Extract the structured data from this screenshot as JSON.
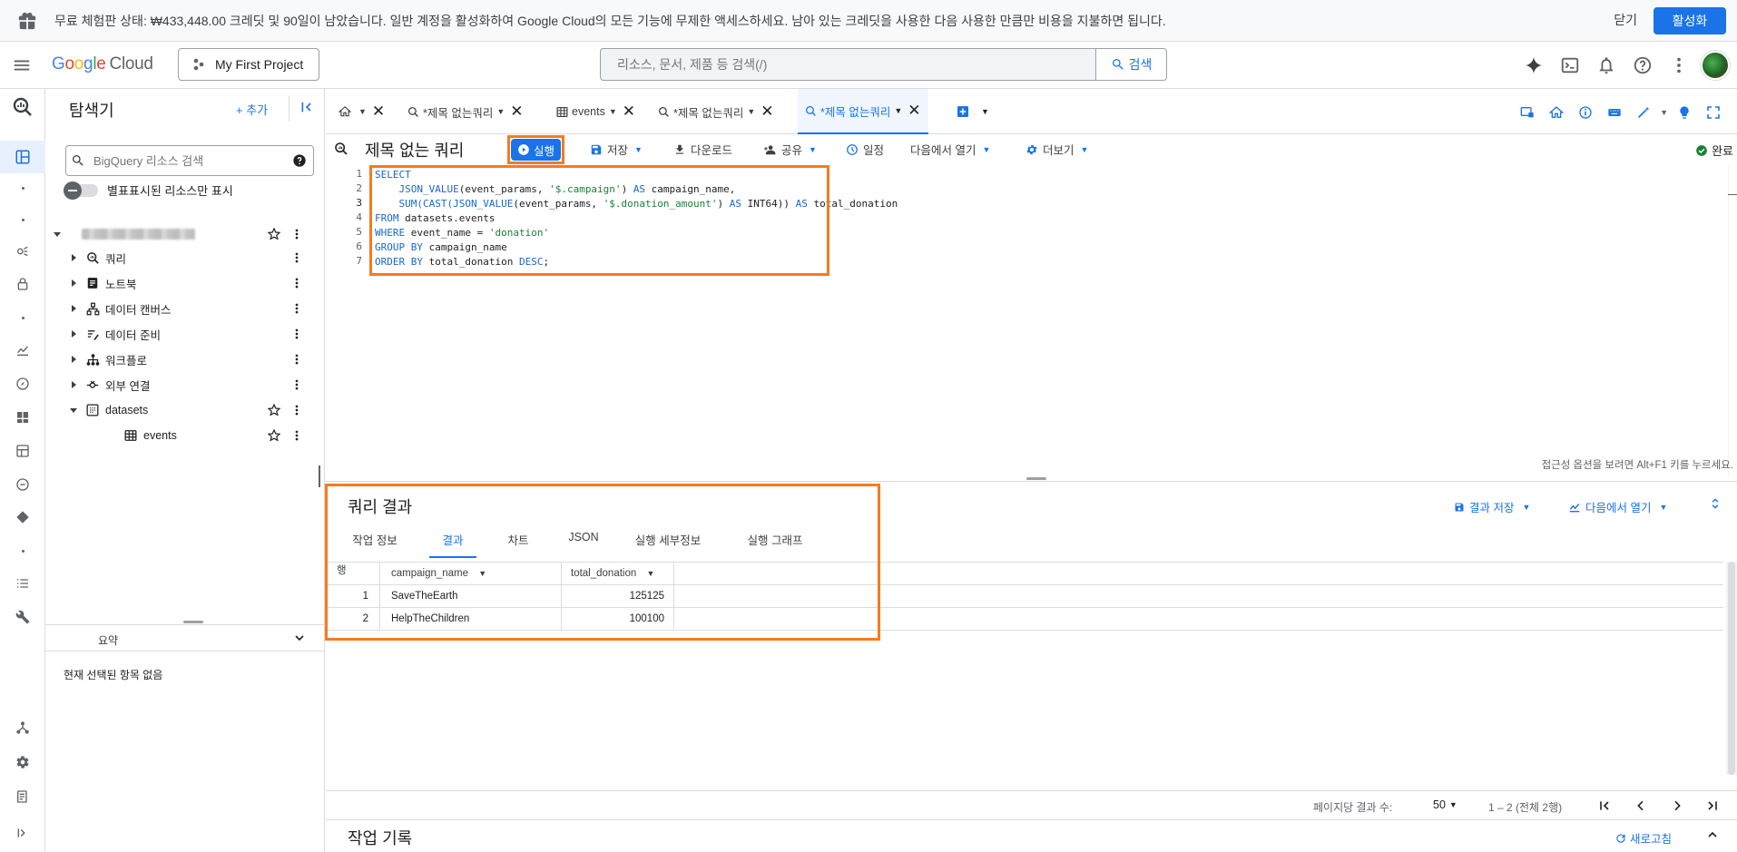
{
  "banner": {
    "message": "무료 체험판 상태: ₩433,448.00 크레딧 및 90일이 남았습니다. 일반 계정을 활성화하여 Google Cloud의 모든 기능에 무제한 액세스하세요. 남아 있는 크레딧을 사용한 다음 사용한 만큼만 비용을 지불하면 됩니다.",
    "dismiss_label": "닫기",
    "activate_label": "활성화"
  },
  "header": {
    "logo_google": [
      "G",
      "o",
      "o",
      "g",
      "l",
      "e"
    ],
    "logo_cloud": "Cloud",
    "project_name": "My First Project",
    "search_placeholder": "리소스, 문서, 제품 등 검색(/)",
    "search_button": "검색"
  },
  "explorer": {
    "title": "탐색기",
    "add_label": "+ 추가",
    "search_placeholder": "BigQuery 리소스 검색",
    "toggle_label": "별표표시된 리소스만 표시",
    "items": [
      {
        "label": "쿼리"
      },
      {
        "label": "노트북"
      },
      {
        "label": "데이터 캔버스"
      },
      {
        "label": "데이터 준비"
      },
      {
        "label": "워크플로"
      },
      {
        "label": "외부 연결"
      },
      {
        "label": "datasets"
      },
      {
        "label": "events"
      }
    ],
    "summary_label": "요약",
    "no_selection": "현재 선택된 항목 없음"
  },
  "tabs": [
    {
      "label": ""
    },
    {
      "label": "*제목 없는쿼리"
    },
    {
      "label": "events"
    },
    {
      "label": "*제목 없는쿼리"
    },
    {
      "label": "*제목 없는쿼리"
    }
  ],
  "toolbar": {
    "query_title": "제목 없는 쿼리",
    "run": "실행",
    "save": "저장",
    "download": "다운로드",
    "share": "공유",
    "schedule": "일정",
    "open_in": "다음에서 열기",
    "more": "더보기",
    "status": "완료"
  },
  "editor": {
    "line_numbers": [
      "1",
      "2",
      "3",
      "4",
      "5",
      "6",
      "7"
    ],
    "accessibility_hint": "접근성 옵션을 보려면 Alt+F1 키를 누르세요."
  },
  "results": {
    "title": "쿼리 결과",
    "save_results": "결과 저장",
    "open_in": "다음에서 열기",
    "tabs": [
      "작업 정보",
      "결과",
      "차트",
      "JSON",
      "실행 세부정보",
      "실행 그래프"
    ],
    "columns": [
      "행",
      "campaign_name",
      "total_donation"
    ],
    "rows": [
      {
        "row": "1",
        "campaign_name": "SaveTheEarth",
        "total_donation": "125125"
      },
      {
        "row": "2",
        "campaign_name": "HelpTheChildren",
        "total_donation": "100100"
      }
    ],
    "per_page_label": "페이지당 결과 수:",
    "per_page_value": "50",
    "range": "1 – 2 (전체 2행)"
  },
  "history": {
    "title": "작업 기록",
    "refresh": "새로고침"
  },
  "colors": {
    "accent": "#1a73e8",
    "highlight_outline": "#f47b20"
  }
}
